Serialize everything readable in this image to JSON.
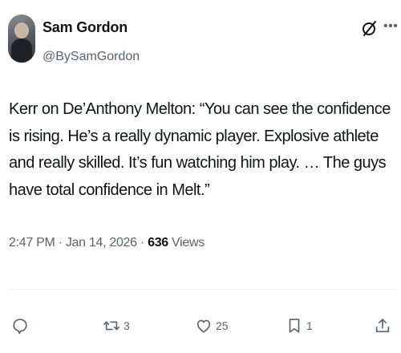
{
  "author": {
    "name": "Sam Gordon",
    "handle": "@BySamGordon"
  },
  "tweet": {
    "text": "Kerr on De’Anthony Melton: “You can see the confidence is rising. He’s a really dynamic player. Explosive athlete and really skilled. It’s fun watching him play. … The guys have total confidence in Melt.”"
  },
  "meta": {
    "time": "2:47 PM",
    "separator": " · ",
    "date": "Jan 14, 2026",
    "views_count": "636",
    "views_label": " Views"
  },
  "actions": {
    "replies": "",
    "reposts": "3",
    "likes": "25",
    "bookmarks": "1"
  },
  "icons": {
    "top_right": [
      "grok-icon",
      "more-icon"
    ],
    "actions": [
      "reply-icon",
      "repost-icon",
      "like-icon",
      "bookmark-icon",
      "share-icon"
    ]
  },
  "colors": {
    "text": "#0f1419",
    "secondary": "#536471",
    "divider": "#eff3f4"
  }
}
